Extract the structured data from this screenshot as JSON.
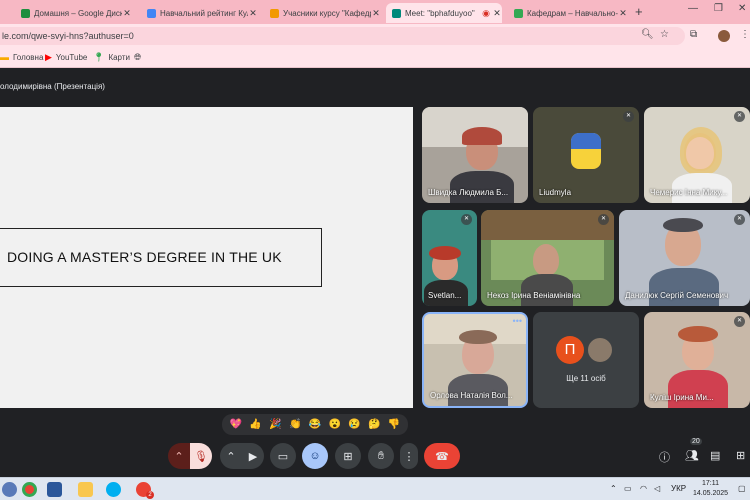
{
  "browser": {
    "tabs": [
      {
        "label": "Домашня – Google Диск",
        "favicon_color": "#1e8e3e"
      },
      {
        "label": "Навчальний рейтинг Кул",
        "favicon_color": "#4285f4"
      },
      {
        "label": "Учасники курсу \"Кафедр",
        "favicon_color": "#f29900"
      },
      {
        "label": "Meet: \"bphafduyoo\"",
        "favicon_color": "#00897b"
      },
      {
        "label": "Кафедрам – Навчально-м",
        "favicon_color": "#34a853"
      }
    ],
    "address": "le.com/qwe-svyi-hns?authuser=0",
    "bookmarks": [
      {
        "label": "Головна",
        "icon": "folder-icon"
      },
      {
        "label": "YouTube",
        "icon": "youtube-icon"
      },
      {
        "label": "Карти",
        "icon": "maps-icon"
      }
    ]
  },
  "meet": {
    "presenter_label": "олодимирівна (Презентація)",
    "slide_title": "DOING A MASTER’S DEGREE IN THE UK",
    "participants": [
      {
        "name": "Швидка Людмила Б..."
      },
      {
        "name": "Liudmyla"
      },
      {
        "name": "Чемерис Інна Мику..."
      },
      {
        "name": "Svetlan..."
      },
      {
        "name": "Некоз Ірина Веніамінівна"
      },
      {
        "name": "Данилюк Сергій Семенович"
      },
      {
        "name": "Орлова Наталія Вол..."
      },
      {
        "name": "Ще 11 осіб",
        "avatar_letter": "П"
      },
      {
        "name": "Куліш Ірина Ми..."
      }
    ],
    "reactions": [
      "💖",
      "👍",
      "🎉",
      "👏",
      "😂",
      "😮",
      "😢",
      "🤔",
      "👎"
    ],
    "people_count": "20"
  },
  "taskbar": {
    "language": "УКР",
    "time": "17:11",
    "date": "14.05.2025",
    "chrome_badge": "2"
  }
}
